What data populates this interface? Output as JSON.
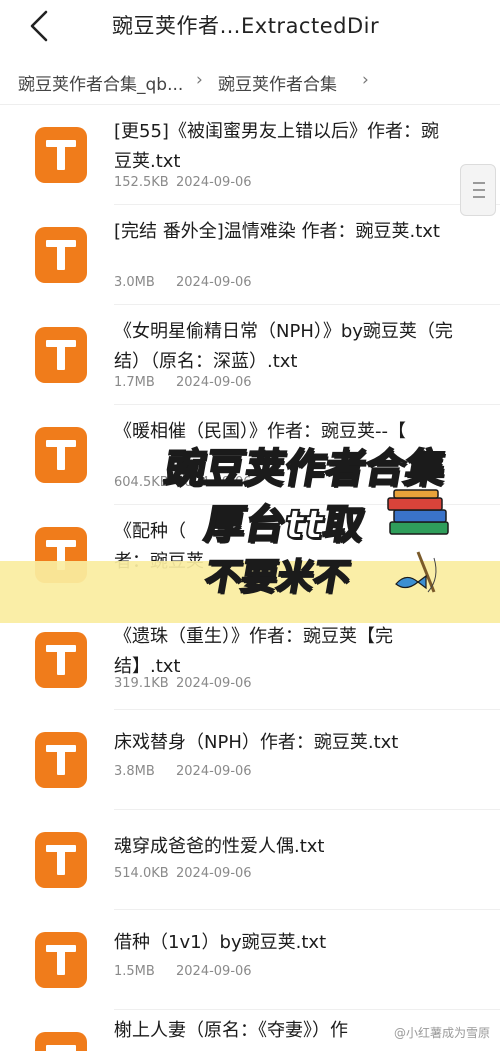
{
  "header": {
    "title": "豌豆荚作者…ExtractedDir"
  },
  "breadcrumb": {
    "items": [
      {
        "label": "豌豆荚作者合集_qb..."
      },
      {
        "label": "豌豆荚作者合集"
      }
    ],
    "separator": "›"
  },
  "icons": {
    "back": "chevron-left-icon",
    "file": "txt-file-icon",
    "scroll": "scroll-handle-icon",
    "books": "books-icon",
    "fish": "fish-icon"
  },
  "colors": {
    "file_icon": "#f07c1b",
    "banner_band": "#faeda0",
    "meta_text": "#8a8a8a"
  },
  "files": [
    {
      "name": "[更55]《被闺蜜男友上错以后》作者：豌豆荚.txt",
      "size": "152.5KB",
      "date": "2024-09-06"
    },
    {
      "name": "[完结 番外全]温情难染 作者：豌豆荚.txt",
      "size": "3.0MB",
      "date": "2024-09-06"
    },
    {
      "name": "《女明星偷精日常（NPH）》by豌豆荚（完结）（原名：深蓝）.txt",
      "size": "1.7MB",
      "date": "2024-09-06"
    },
    {
      "name": "《暖相催（民国）》作者：豌豆荚--【",
      "size": "604.5KB",
      "date": "2024-09-06"
    },
    {
      "name": "《配种（",
      "name_cont": "者：豌豆荚",
      "size": "",
      "date": ""
    },
    {
      "name": "《遗珠（重生）》作者：豌豆荚【完结】.txt",
      "size": "319.1KB",
      "date": "2024-09-06"
    },
    {
      "name": "床戏替身（NPH）作者：豌豆荚.txt",
      "size": "3.8MB",
      "date": "2024-09-06"
    },
    {
      "name": "魂穿成爸爸的性爱人偶.txt",
      "size": "514.0KB",
      "date": "2024-09-06"
    },
    {
      "name": "借种（1v1）by豌豆荚.txt",
      "size": "1.5MB",
      "date": "2024-09-06"
    },
    {
      "name": "榭上人妻（原名：《夺妻》）作",
      "size": "",
      "date": ""
    }
  ],
  "overlay": {
    "line1": "豌豆荚作者合集",
    "line2": "厚台tt取",
    "line3": "不要米不"
  },
  "watermark": "@小红薯成为雪原"
}
